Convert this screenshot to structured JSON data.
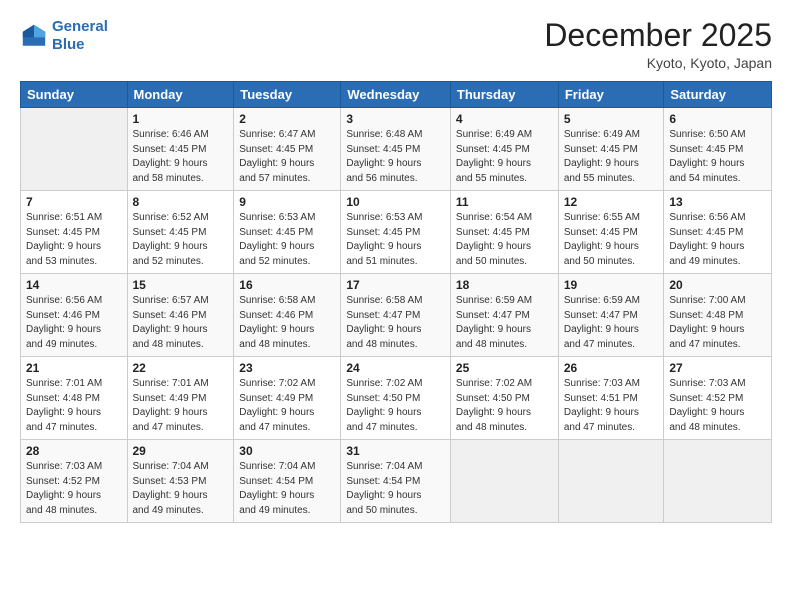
{
  "logo": {
    "line1": "General",
    "line2": "Blue"
  },
  "header": {
    "month": "December 2025",
    "location": "Kyoto, Kyoto, Japan"
  },
  "weekdays": [
    "Sunday",
    "Monday",
    "Tuesday",
    "Wednesday",
    "Thursday",
    "Friday",
    "Saturday"
  ],
  "weeks": [
    [
      {
        "day": "",
        "info": ""
      },
      {
        "day": "1",
        "info": "Sunrise: 6:46 AM\nSunset: 4:45 PM\nDaylight: 9 hours\nand 58 minutes."
      },
      {
        "day": "2",
        "info": "Sunrise: 6:47 AM\nSunset: 4:45 PM\nDaylight: 9 hours\nand 57 minutes."
      },
      {
        "day": "3",
        "info": "Sunrise: 6:48 AM\nSunset: 4:45 PM\nDaylight: 9 hours\nand 56 minutes."
      },
      {
        "day": "4",
        "info": "Sunrise: 6:49 AM\nSunset: 4:45 PM\nDaylight: 9 hours\nand 55 minutes."
      },
      {
        "day": "5",
        "info": "Sunrise: 6:49 AM\nSunset: 4:45 PM\nDaylight: 9 hours\nand 55 minutes."
      },
      {
        "day": "6",
        "info": "Sunrise: 6:50 AM\nSunset: 4:45 PM\nDaylight: 9 hours\nand 54 minutes."
      }
    ],
    [
      {
        "day": "7",
        "info": "Sunrise: 6:51 AM\nSunset: 4:45 PM\nDaylight: 9 hours\nand 53 minutes."
      },
      {
        "day": "8",
        "info": "Sunrise: 6:52 AM\nSunset: 4:45 PM\nDaylight: 9 hours\nand 52 minutes."
      },
      {
        "day": "9",
        "info": "Sunrise: 6:53 AM\nSunset: 4:45 PM\nDaylight: 9 hours\nand 52 minutes."
      },
      {
        "day": "10",
        "info": "Sunrise: 6:53 AM\nSunset: 4:45 PM\nDaylight: 9 hours\nand 51 minutes."
      },
      {
        "day": "11",
        "info": "Sunrise: 6:54 AM\nSunset: 4:45 PM\nDaylight: 9 hours\nand 50 minutes."
      },
      {
        "day": "12",
        "info": "Sunrise: 6:55 AM\nSunset: 4:45 PM\nDaylight: 9 hours\nand 50 minutes."
      },
      {
        "day": "13",
        "info": "Sunrise: 6:56 AM\nSunset: 4:45 PM\nDaylight: 9 hours\nand 49 minutes."
      }
    ],
    [
      {
        "day": "14",
        "info": "Sunrise: 6:56 AM\nSunset: 4:46 PM\nDaylight: 9 hours\nand 49 minutes."
      },
      {
        "day": "15",
        "info": "Sunrise: 6:57 AM\nSunset: 4:46 PM\nDaylight: 9 hours\nand 48 minutes."
      },
      {
        "day": "16",
        "info": "Sunrise: 6:58 AM\nSunset: 4:46 PM\nDaylight: 9 hours\nand 48 minutes."
      },
      {
        "day": "17",
        "info": "Sunrise: 6:58 AM\nSunset: 4:47 PM\nDaylight: 9 hours\nand 48 minutes."
      },
      {
        "day": "18",
        "info": "Sunrise: 6:59 AM\nSunset: 4:47 PM\nDaylight: 9 hours\nand 48 minutes."
      },
      {
        "day": "19",
        "info": "Sunrise: 6:59 AM\nSunset: 4:47 PM\nDaylight: 9 hours\nand 47 minutes."
      },
      {
        "day": "20",
        "info": "Sunrise: 7:00 AM\nSunset: 4:48 PM\nDaylight: 9 hours\nand 47 minutes."
      }
    ],
    [
      {
        "day": "21",
        "info": "Sunrise: 7:01 AM\nSunset: 4:48 PM\nDaylight: 9 hours\nand 47 minutes."
      },
      {
        "day": "22",
        "info": "Sunrise: 7:01 AM\nSunset: 4:49 PM\nDaylight: 9 hours\nand 47 minutes."
      },
      {
        "day": "23",
        "info": "Sunrise: 7:02 AM\nSunset: 4:49 PM\nDaylight: 9 hours\nand 47 minutes."
      },
      {
        "day": "24",
        "info": "Sunrise: 7:02 AM\nSunset: 4:50 PM\nDaylight: 9 hours\nand 47 minutes."
      },
      {
        "day": "25",
        "info": "Sunrise: 7:02 AM\nSunset: 4:50 PM\nDaylight: 9 hours\nand 48 minutes."
      },
      {
        "day": "26",
        "info": "Sunrise: 7:03 AM\nSunset: 4:51 PM\nDaylight: 9 hours\nand 47 minutes."
      },
      {
        "day": "27",
        "info": "Sunrise: 7:03 AM\nSunset: 4:52 PM\nDaylight: 9 hours\nand 48 minutes."
      }
    ],
    [
      {
        "day": "28",
        "info": "Sunrise: 7:03 AM\nSunset: 4:52 PM\nDaylight: 9 hours\nand 48 minutes."
      },
      {
        "day": "29",
        "info": "Sunrise: 7:04 AM\nSunset: 4:53 PM\nDaylight: 9 hours\nand 49 minutes."
      },
      {
        "day": "30",
        "info": "Sunrise: 7:04 AM\nSunset: 4:54 PM\nDaylight: 9 hours\nand 49 minutes."
      },
      {
        "day": "31",
        "info": "Sunrise: 7:04 AM\nSunset: 4:54 PM\nDaylight: 9 hours\nand 50 minutes."
      },
      {
        "day": "",
        "info": ""
      },
      {
        "day": "",
        "info": ""
      },
      {
        "day": "",
        "info": ""
      }
    ]
  ]
}
